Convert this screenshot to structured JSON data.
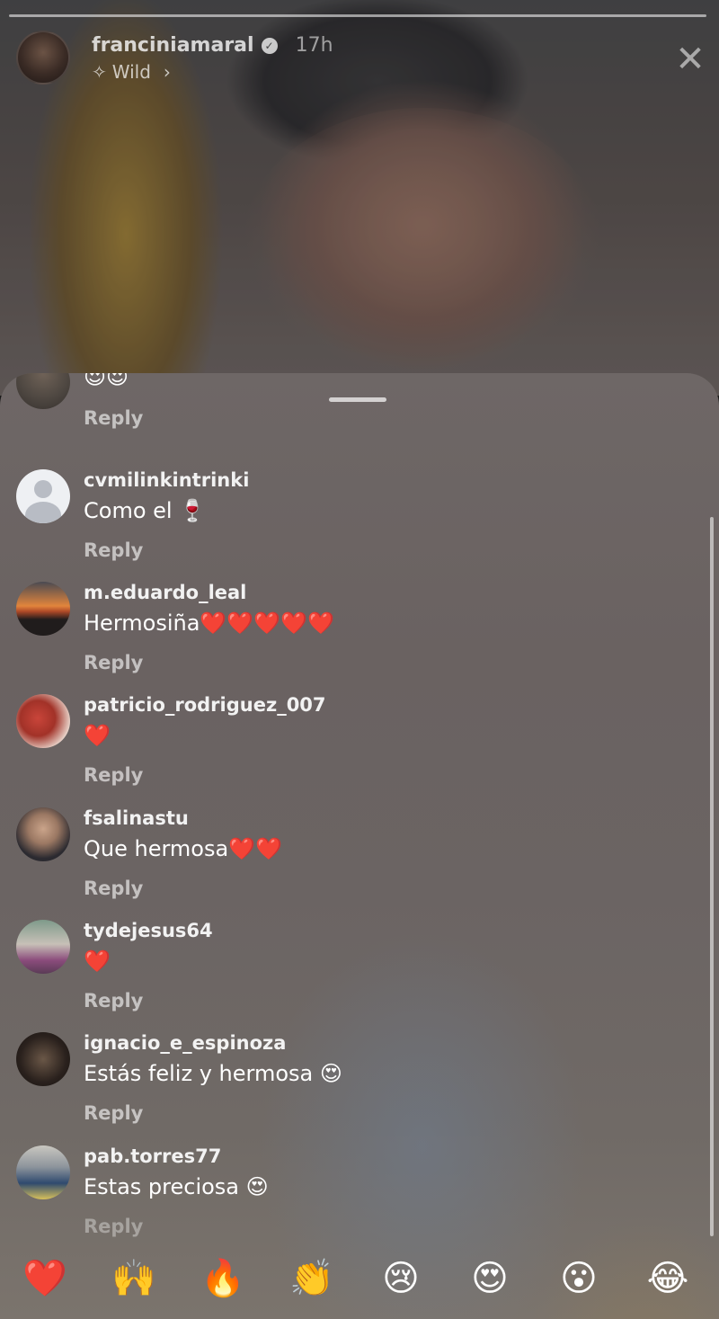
{
  "story": {
    "username": "franciniamaral",
    "time": "17h",
    "music": "Wild"
  },
  "comments": [
    {
      "username": "",
      "text": "😍😍",
      "reply": "Reply"
    },
    {
      "username": "cvmilinkintrinki",
      "text": "Como el 🍷",
      "reply": "Reply"
    },
    {
      "username": "m.eduardo_leal",
      "text": "Hermosiña❤️❤️❤️❤️❤️",
      "reply": "Reply"
    },
    {
      "username": "patricio_rodriguez_007",
      "text": "❤️",
      "reply": "Reply"
    },
    {
      "username": "fsalinastu",
      "text": "Que hermosa❤️❤️",
      "reply": "Reply"
    },
    {
      "username": "tydejesus64",
      "text": "❤️",
      "reply": "Reply"
    },
    {
      "username": "ignacio_e_espinoza",
      "text": "Estás feliz y hermosa 😍",
      "reply": "Reply"
    },
    {
      "username": "pab.torres77",
      "text": "Estas preciosa 😍",
      "reply": "Reply"
    }
  ],
  "reactions": [
    "❤️",
    "🙌",
    "🔥",
    "👏",
    "😢",
    "😍",
    "😮",
    "😂"
  ],
  "icons": {
    "verified": "verified-badge-icon",
    "music": "sparkle-music-icon",
    "close": "close-icon",
    "chevron": "chevron-right-icon"
  }
}
